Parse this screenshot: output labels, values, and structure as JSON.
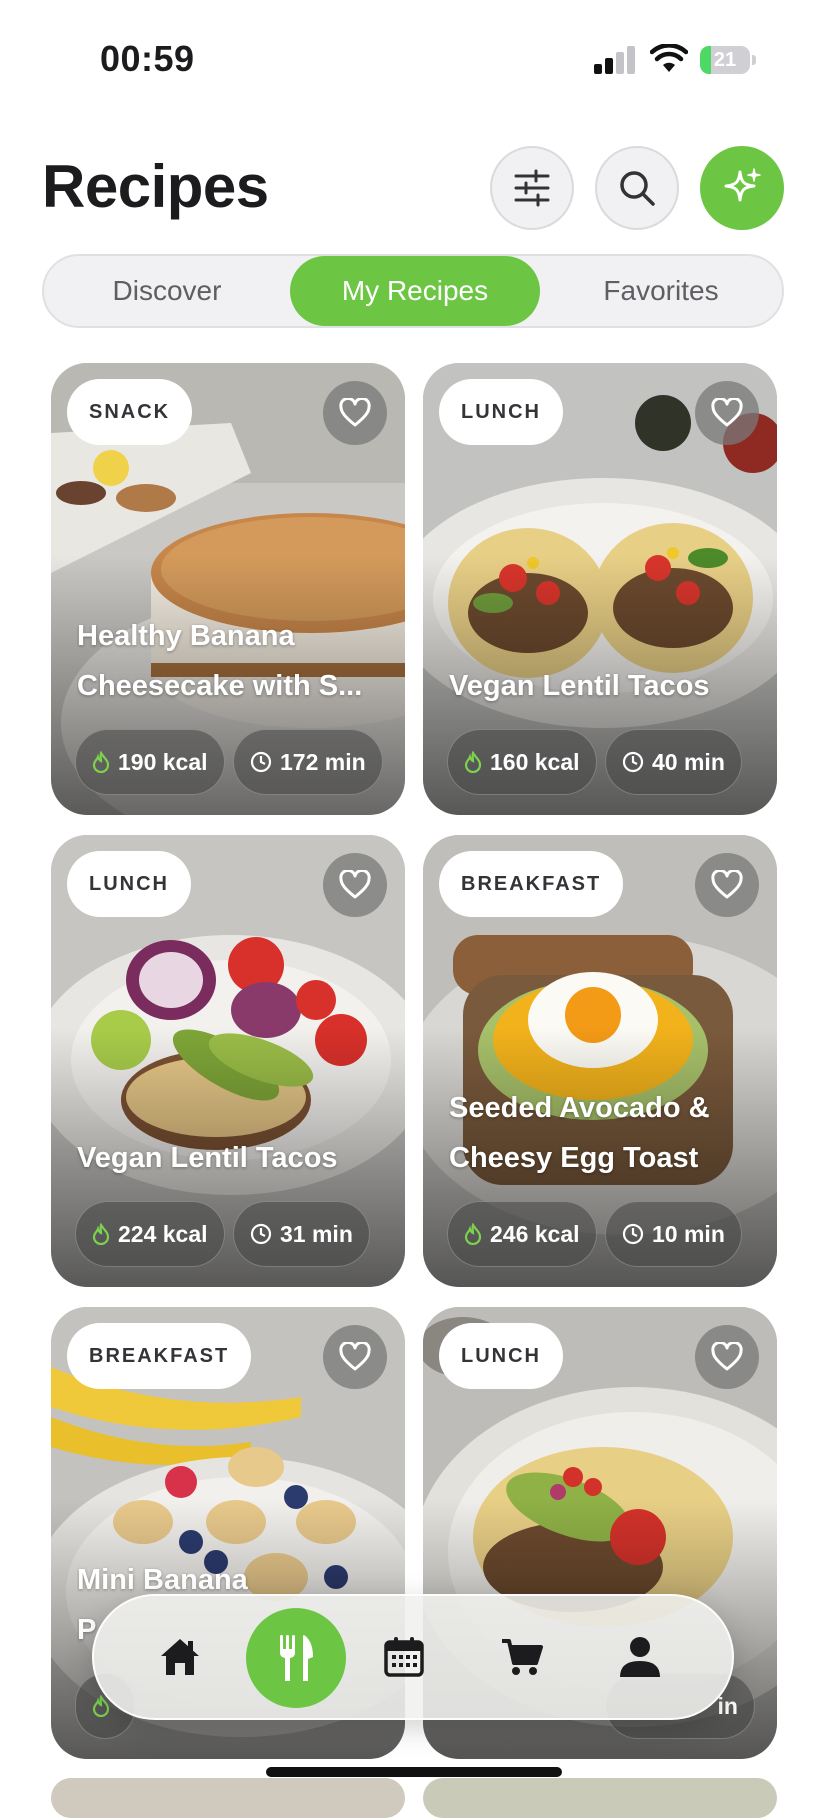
{
  "status_bar": {
    "time": "00:59",
    "battery": "21",
    "battery_level": 0.21
  },
  "header": {
    "title": "Recipes"
  },
  "header_buttons": [
    {
      "name": "filter-button",
      "icon": "sliders-icon"
    },
    {
      "name": "search-button",
      "icon": "search-icon"
    },
    {
      "name": "ai-sparkle-button",
      "icon": "sparkle-icon"
    }
  ],
  "tabs": [
    {
      "label": "Discover",
      "active": false
    },
    {
      "label": "My Recipes",
      "active": true
    },
    {
      "label": "Favorites",
      "active": false
    }
  ],
  "recipes": [
    {
      "category": "SNACK",
      "title_lines": [
        "Healthy Banana",
        "Cheesecake with S..."
      ],
      "kcal": "190 kcal",
      "time": "172 min",
      "favorite": false
    },
    {
      "category": "LUNCH",
      "title_lines": [
        "",
        "Vegan Lentil Tacos"
      ],
      "kcal": "160 kcal",
      "time": "40 min",
      "favorite": false
    },
    {
      "category": "LUNCH",
      "title_lines": [
        "",
        "Vegan Lentil Tacos"
      ],
      "kcal": "224 kcal",
      "time": "31 min",
      "favorite": false
    },
    {
      "category": "BREAKFAST",
      "title_lines": [
        "Seeded Avocado &",
        "Cheesy Egg Toast"
      ],
      "kcal": "246 kcal",
      "time": "10 min",
      "favorite": false
    },
    {
      "category": "BREAKFAST",
      "title_lines": [
        "Mini Banana",
        "P"
      ],
      "kcal": "",
      "time": "",
      "favorite": false
    },
    {
      "category": "LUNCH",
      "title_lines": [
        "",
        ""
      ],
      "kcal": "",
      "time": "in",
      "favorite": false
    }
  ],
  "bottom_nav": [
    {
      "name": "nav-home",
      "icon": "home-icon",
      "active": false
    },
    {
      "name": "nav-recipes",
      "icon": "fork-knife-icon",
      "active": true
    },
    {
      "name": "nav-calendar",
      "icon": "calendar-icon",
      "active": false
    },
    {
      "name": "nav-cart",
      "icon": "cart-icon",
      "active": false
    },
    {
      "name": "nav-profile",
      "icon": "person-icon",
      "active": false
    }
  ],
  "colors": {
    "accent": "#6cc644",
    "text": "#1c1c1e"
  }
}
